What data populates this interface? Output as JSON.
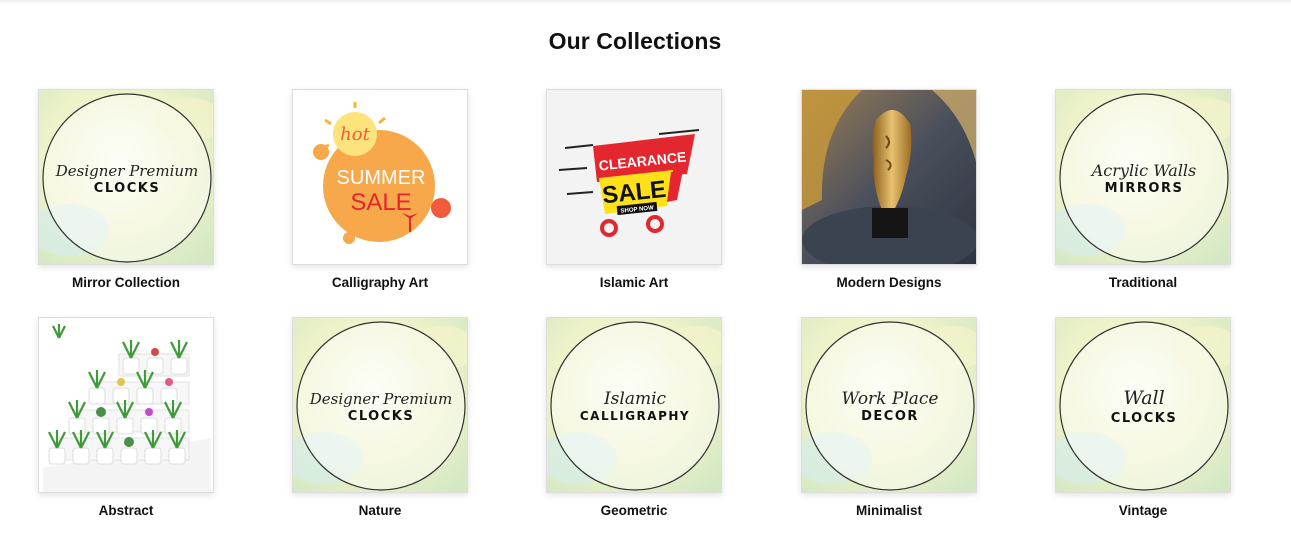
{
  "header": {
    "title": "Our Collections"
  },
  "collections": [
    {
      "label": "Mirror Collection",
      "image": "watercolor-circle-art",
      "script": "Designer Premium",
      "caps": "CLOCKS"
    },
    {
      "label": "Calligraphy Art",
      "image": "summer-sale-badge",
      "small": "hot",
      "line1": "SUMMER",
      "line2": "SALE"
    },
    {
      "label": "Islamic Art",
      "image": "clearance-sale-cart",
      "line1": "CLEARANCE",
      "line2": "SALE",
      "small": "SHOP NOW"
    },
    {
      "label": "Modern Designs",
      "image": "gold-face-sculpture-photo"
    },
    {
      "label": "Traditional",
      "image": "watercolor-circle-art",
      "script": "Acrylic Walls",
      "caps": "MIRRORS"
    },
    {
      "label": "Abstract",
      "image": "potted-plants-shelf-photo"
    },
    {
      "label": "Nature",
      "image": "watercolor-circle-art",
      "script": "Designer Premium",
      "caps": "CLOCKS"
    },
    {
      "label": "Geometric",
      "image": "watercolor-circle-art",
      "script": "Islamic",
      "caps": "CALLIGRAPHY"
    },
    {
      "label": "Minimalist",
      "image": "watercolor-circle-art",
      "script": "Work Place",
      "caps": "DECOR"
    },
    {
      "label": "Vintage",
      "image": "watercolor-circle-art",
      "script": "Wall",
      "caps": "CLOCKS"
    }
  ],
  "colors": {
    "watercolor_yellow": "#eef2c8",
    "watercolor_green": "#d3e8c4",
    "watercolor_teal": "#d6ece9",
    "sale_orange": "#f6a84a",
    "sale_red": "#e4262f",
    "sale_yellow": "#ffe11a",
    "gold": "#c99a3a"
  }
}
